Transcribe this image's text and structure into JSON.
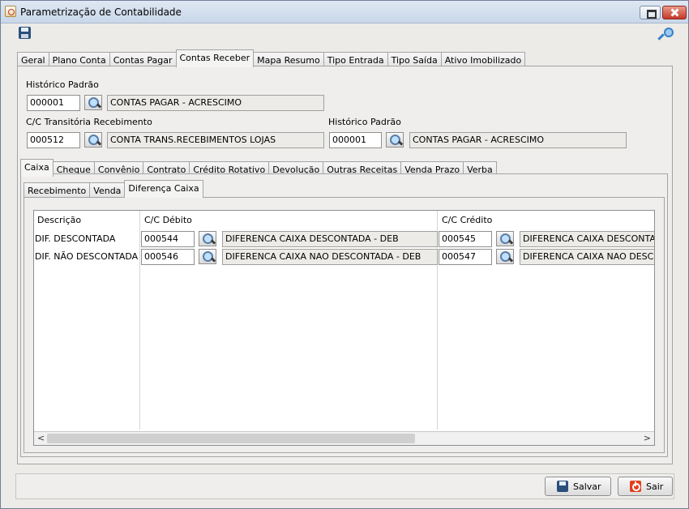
{
  "window": {
    "title": "Parametrização de Contabilidade"
  },
  "toolbar": {
    "save_icon": "save-icon",
    "key_icon": "key-icon"
  },
  "outer_tabs": [
    "Geral",
    "Plano Conta",
    "Contas Pagar",
    "Contas Receber",
    "Mapa Resumo",
    "Tipo Entrada",
    "Tipo Saída",
    "Ativo Imobilizado"
  ],
  "outer_tab_active": "Contas Receber",
  "contas_receber": {
    "historico_padrao_label": "Histórico Padrão",
    "historico_padrao_code": "000001",
    "historico_padrao_desc": "CONTAS PAGAR - ACRESCIMO",
    "cc_transitoria_label": "C/C Transitória Recebimento",
    "cc_transitoria_code": "000512",
    "cc_transitoria_desc": "CONTA TRANS.RECEBIMENTOS LOJAS",
    "historico_padrao2_label": "Histórico Padrão",
    "historico_padrao2_code": "000001",
    "historico_padrao2_desc": "CONTAS PAGAR - ACRESCIMO"
  },
  "inner_tabs": [
    "Caixa",
    "Cheque",
    "Convênio",
    "Contrato",
    "Crédito Rotativo",
    "Devolução",
    "Outras Receitas",
    "Venda Prazo",
    "Verba"
  ],
  "inner_tab_active": "Caixa",
  "sub_tabs": [
    "Recebimento",
    "Venda",
    "Diferença Caixa"
  ],
  "sub_tab_active": "Diferença Caixa",
  "grid": {
    "headers": {
      "descricao": "Descrição",
      "cc_debito": "C/C Débito",
      "cc_credito": "C/C Crédito"
    },
    "rows": [
      {
        "descricao": "DIF. DESCONTADA",
        "debito_code": "000544",
        "debito_desc": "DIFERENCA CAIXA DESCONTADA - DEB",
        "credito_code": "000545",
        "credito_desc": "DIFERENCA CAIXA DESCONTADA - CRED"
      },
      {
        "descricao": "DIF. NÃO DESCONTADA",
        "debito_code": "000546",
        "debito_desc": "DIFERENCA CAIXA NAO DESCONTADA - DEB",
        "credito_code": "000547",
        "credito_desc": "DIFERENCA CAIXA NAO DESCONTADA - CRED"
      }
    ]
  },
  "buttons": {
    "save": "Salvar",
    "exit": "Sair"
  }
}
